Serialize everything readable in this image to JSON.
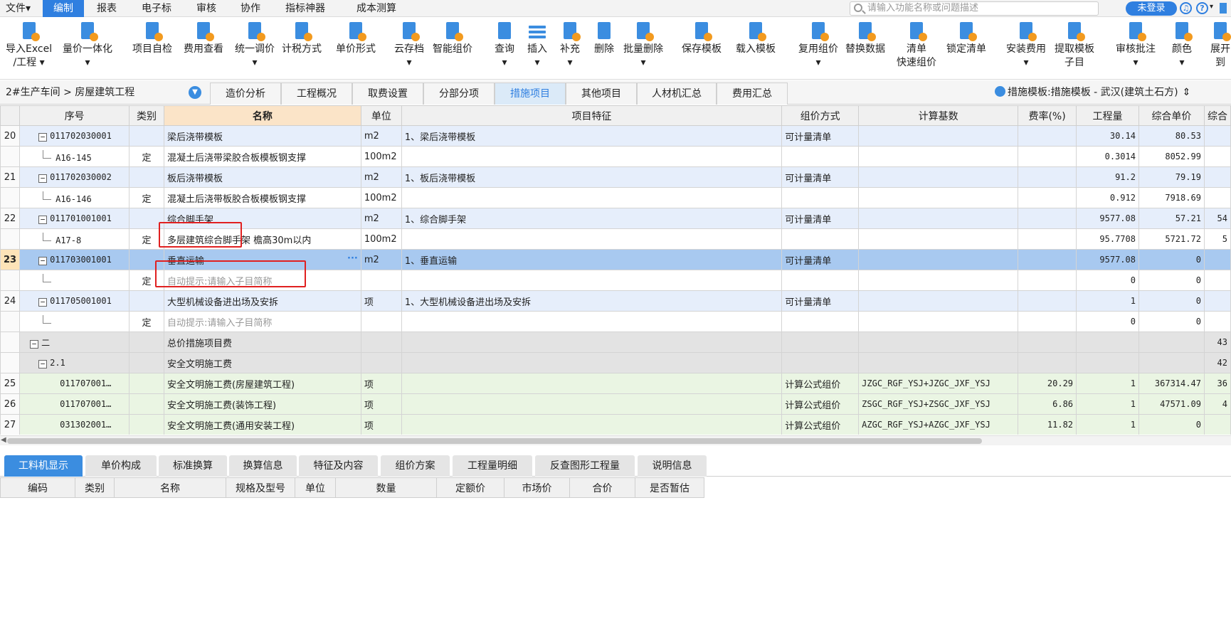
{
  "menu": {
    "file": "文件▾",
    "items": [
      "编制",
      "报表",
      "电子标",
      "审核",
      "协作",
      "指标神器",
      "成本测算"
    ]
  },
  "search": {
    "placeholder": "请输入功能名称或问题描述"
  },
  "login": "未登录",
  "toolbar": [
    {
      "line1": "导入Excel",
      "line2": "/工程 ▾",
      "icon": "import-excel-icon"
    },
    {
      "line1": "量价一体化",
      "line2": "▾",
      "icon": "quantity-price-icon"
    },
    {
      "line1": "项目自检",
      "line2": "",
      "icon": "self-check-icon"
    },
    {
      "line1": "费用查看",
      "line2": "",
      "icon": "fee-view-icon"
    },
    {
      "line1": "统一调价",
      "line2": "▾",
      "icon": "price-adjust-icon"
    },
    {
      "line1": "计税方式",
      "line2": "",
      "icon": "tax-method-icon"
    },
    {
      "line1": "单价形式",
      "line2": "",
      "icon": "unit-price-form-icon"
    },
    {
      "line1": "云存档",
      "line2": "▾",
      "icon": "cloud-archive-icon"
    },
    {
      "line1": "智能组价",
      "line2": "",
      "icon": "smart-pricing-icon"
    },
    {
      "line1": "查询",
      "line2": "▾",
      "icon": "query-icon"
    },
    {
      "line1": "插入",
      "line2": "▾",
      "icon": "insert-icon"
    },
    {
      "line1": "补充",
      "line2": "▾",
      "icon": "supplement-icon"
    },
    {
      "line1": "删除",
      "line2": "",
      "icon": "delete-icon"
    },
    {
      "line1": "批量删除",
      "line2": "▾",
      "icon": "batch-delete-icon"
    },
    {
      "line1": "保存模板",
      "line2": "",
      "icon": "save-template-icon"
    },
    {
      "line1": "载入模板",
      "line2": "",
      "icon": "load-template-icon"
    },
    {
      "line1": "复用组价",
      "line2": "▾",
      "icon": "reuse-pricing-icon"
    },
    {
      "line1": "替换数据",
      "line2": "",
      "icon": "replace-data-icon"
    },
    {
      "line1": "清单",
      "line2": "快速组价",
      "icon": "list-quick-pricing-icon"
    },
    {
      "line1": "锁定清单",
      "line2": "",
      "icon": "lock-list-icon"
    },
    {
      "line1": "安装费用",
      "line2": "▾",
      "icon": "install-fee-icon"
    },
    {
      "line1": "提取模板",
      "line2": "子目",
      "icon": "extract-template-icon"
    },
    {
      "line1": "审核批注",
      "line2": "▾",
      "icon": "review-annotation-icon"
    },
    {
      "line1": "颜色",
      "line2": "▾",
      "icon": "color-icon"
    },
    {
      "line1": "展开到",
      "line2": "",
      "icon": "expand-to-icon"
    }
  ],
  "breadcrumb": "2#生产车间 > 房屋建筑工程",
  "nav_tabs": [
    "造价分析",
    "工程概况",
    "取费设置",
    "分部分项",
    "措施项目",
    "其他项目",
    "人材机汇总",
    "费用汇总"
  ],
  "nav_active": "措施项目",
  "template_label": "措施模板:措施模板 - 武汉(建筑土石方)",
  "grid": {
    "headers": [
      "序号",
      "类别",
      "名称",
      "单位",
      "项目特征",
      "组价方式",
      "计算基数",
      "费率(%)",
      "工程量",
      "综合单价",
      "综合"
    ],
    "rows": [
      {
        "no": "20",
        "code": "011702030001",
        "type": "",
        "name": "梁后浇带模板",
        "unit": "m2",
        "feature": "1、梁后浇带模板",
        "method": "可计量清单",
        "base": "",
        "rate": "",
        "qty": "30.14",
        "price": "80.53",
        "total": "",
        "kind": "list"
      },
      {
        "no": "",
        "code": "A16-145",
        "type": "定",
        "name": "混凝土后浇带梁胶合板模板钢支撑",
        "unit": "100m2",
        "feature": "",
        "method": "",
        "base": "",
        "rate": "",
        "qty": "0.3014",
        "price": "8052.99",
        "total": "",
        "kind": "def"
      },
      {
        "no": "21",
        "code": "011702030002",
        "type": "",
        "name": "板后浇带模板",
        "unit": "m2",
        "feature": "1、板后浇带模板",
        "method": "可计量清单",
        "base": "",
        "rate": "",
        "qty": "91.2",
        "price": "79.19",
        "total": "",
        "kind": "list"
      },
      {
        "no": "",
        "code": "A16-146",
        "type": "定",
        "name": "混凝土后浇带板胶合板模板钢支撑",
        "unit": "100m2",
        "feature": "",
        "method": "",
        "base": "",
        "rate": "",
        "qty": "0.912",
        "price": "7918.69",
        "total": "",
        "kind": "def"
      },
      {
        "no": "22",
        "code": "011701001001",
        "type": "",
        "name": "综合脚手架",
        "unit": "m2",
        "feature": "1、综合脚手架",
        "method": "可计量清单",
        "base": "",
        "rate": "",
        "qty": "9577.08",
        "price": "57.21",
        "total": "54",
        "kind": "list"
      },
      {
        "no": "",
        "code": "A17-8",
        "type": "定",
        "name": "多层建筑综合脚手架 檐高30m以内",
        "unit": "100m2",
        "feature": "",
        "method": "",
        "base": "",
        "rate": "",
        "qty": "95.7708",
        "price": "5721.72",
        "total": "5",
        "kind": "def"
      },
      {
        "no": "23",
        "code": "011703001001",
        "type": "",
        "name": "垂直运输",
        "unit": "m2",
        "feature": "1、垂直运输",
        "method": "可计量清单",
        "base": "",
        "rate": "",
        "qty": "9577.08",
        "price": "0",
        "total": "",
        "kind": "sel"
      },
      {
        "no": "",
        "code": "",
        "type": "定",
        "name": "自动提示:请输入子目简称",
        "unit": "",
        "feature": "",
        "method": "",
        "base": "",
        "rate": "",
        "qty": "0",
        "price": "0",
        "total": "",
        "kind": "hint"
      },
      {
        "no": "24",
        "code": "011705001001",
        "type": "",
        "name": "大型机械设备进出场及安拆",
        "unit": "项",
        "feature": "1、大型机械设备进出场及安拆",
        "method": "可计量清单",
        "base": "",
        "rate": "",
        "qty": "1",
        "price": "0",
        "total": "",
        "kind": "list"
      },
      {
        "no": "",
        "code": "",
        "type": "定",
        "name": "自动提示:请输入子目简称",
        "unit": "",
        "feature": "",
        "method": "",
        "base": "",
        "rate": "",
        "qty": "0",
        "price": "0",
        "total": "",
        "kind": "hint"
      },
      {
        "no": "",
        "code": "二",
        "type": "",
        "name": "总价措施项目费",
        "unit": "",
        "feature": "",
        "method": "",
        "base": "",
        "rate": "",
        "qty": "",
        "price": "",
        "total": "43",
        "kind": "group1"
      },
      {
        "no": "",
        "code": "2.1",
        "type": "",
        "name": "安全文明施工费",
        "unit": "",
        "feature": "",
        "method": "",
        "base": "",
        "rate": "",
        "qty": "",
        "price": "",
        "total": "42",
        "kind": "group2"
      },
      {
        "no": "25",
        "code": "011707001…",
        "type": "",
        "name": "安全文明施工费(房屋建筑工程)",
        "unit": "项",
        "feature": "",
        "method": "计算公式组价",
        "base": "JZGC_RGF_YSJ+JZGC_JXF_YSJ",
        "rate": "20.29",
        "qty": "1",
        "price": "367314.47",
        "total": "36",
        "kind": "green"
      },
      {
        "no": "26",
        "code": "011707001…",
        "type": "",
        "name": "安全文明施工费(装饰工程)",
        "unit": "项",
        "feature": "",
        "method": "计算公式组价",
        "base": "ZSGC_RGF_YSJ+ZSGC_JXF_YSJ",
        "rate": "6.86",
        "qty": "1",
        "price": "47571.09",
        "total": "4",
        "kind": "green"
      },
      {
        "no": "27",
        "code": "031302001…",
        "type": "",
        "name": "安全文明施工费(通用安装工程)",
        "unit": "项",
        "feature": "",
        "method": "计算公式组价",
        "base": "AZGC_RGF_YSJ+AZGC_JXF_YSJ",
        "rate": "11.82",
        "qty": "1",
        "price": "0",
        "total": "",
        "kind": "green"
      }
    ]
  },
  "bottom_tabs": [
    "工料机显示",
    "单价构成",
    "标准换算",
    "换算信息",
    "特征及内容",
    "组价方案",
    "工程量明细",
    "反查图形工程量",
    "说明信息"
  ],
  "bottom_active": "工料机显示",
  "bottom_headers": [
    "编码",
    "类别",
    "名称",
    "规格及型号",
    "单位",
    "数量",
    "定额价",
    "市场价",
    "合价",
    "是否暂估"
  ],
  "colors": {
    "accent": "#2f7fe0",
    "highlight": "#e02020",
    "selected_row": "#a8c9f0",
    "list_row": "#e6eefb",
    "group_row": "#e3e3e3",
    "green_row": "#eaf5e3"
  }
}
